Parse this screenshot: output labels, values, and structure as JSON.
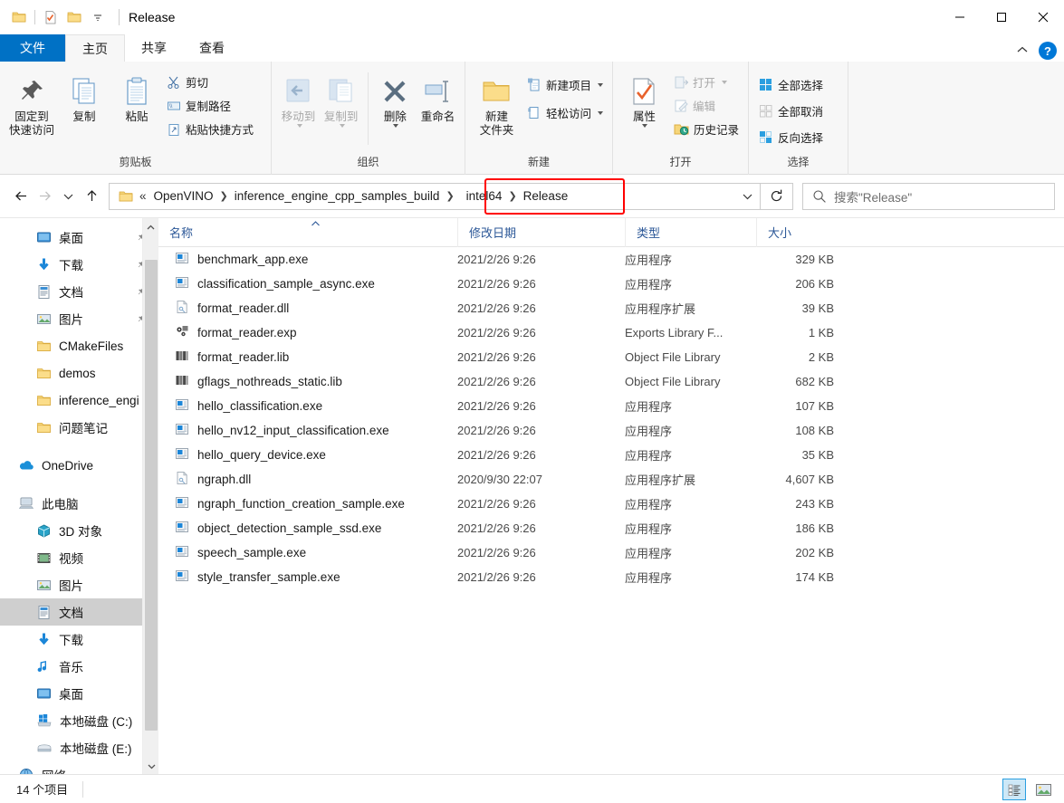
{
  "window": {
    "title": "Release",
    "quick_access": [
      "folder-icon",
      "properties-icon",
      "new-folder-icon",
      "customize-dropdown-icon"
    ],
    "controls": {
      "minimize": "minimize-icon",
      "maximize": "maximize-icon",
      "close": "close-icon"
    }
  },
  "ribbon": {
    "tabs": [
      {
        "label": "文件",
        "kind": "file"
      },
      {
        "label": "主页",
        "kind": "active"
      },
      {
        "label": "共享",
        "kind": "normal"
      },
      {
        "label": "查看",
        "kind": "normal"
      }
    ],
    "collapse_label": "^",
    "help_label": "?",
    "groups": [
      {
        "label": "剪贴板",
        "big": [
          {
            "label": "固定到\n快速访问",
            "line1": "固定到",
            "line2": "快速访问",
            "icon": "pin-icon"
          },
          {
            "label": "复制",
            "icon": "copy-icon"
          },
          {
            "label": "粘贴",
            "icon": "paste-icon"
          }
        ],
        "small": [
          {
            "label": "剪切",
            "icon": "scissors-icon"
          },
          {
            "label": "复制路径",
            "icon": "copy-path-icon"
          },
          {
            "label": "粘贴快捷方式",
            "icon": "paste-shortcut-icon"
          }
        ]
      },
      {
        "label": "组织",
        "big": [
          {
            "label": "移动到",
            "icon": "move-to-icon",
            "disabled": true,
            "dropdown": true
          },
          {
            "label": "复制到",
            "icon": "copy-to-icon",
            "disabled": true,
            "dropdown": true
          },
          {
            "label": "删除",
            "icon": "delete-icon",
            "dropdown": true
          },
          {
            "label": "重命名",
            "icon": "rename-icon"
          }
        ]
      },
      {
        "label": "新建",
        "big": [
          {
            "line1": "新建",
            "line2": "文件夹",
            "label": "新建文件夹",
            "icon": "new-folder-icon"
          }
        ],
        "small": [
          {
            "label": "新建项目",
            "icon": "new-item-icon",
            "dropdown": true
          },
          {
            "label": "轻松访问",
            "icon": "easy-access-icon",
            "dropdown": true
          }
        ]
      },
      {
        "label": "打开",
        "big": [
          {
            "label": "属性",
            "icon": "properties-icon",
            "dropdown": true
          }
        ],
        "small": [
          {
            "label": "打开",
            "icon": "open-icon",
            "disabled": true,
            "dropdown": true
          },
          {
            "label": "编辑",
            "icon": "edit-icon",
            "disabled": true
          },
          {
            "label": "历史记录",
            "icon": "history-icon"
          }
        ]
      },
      {
        "label": "选择",
        "small": [
          {
            "label": "全部选择",
            "icon": "select-all-icon"
          },
          {
            "label": "全部取消",
            "icon": "select-none-icon"
          },
          {
            "label": "反向选择",
            "icon": "invert-selection-icon"
          }
        ]
      }
    ]
  },
  "address": {
    "back": "back-arrow-icon",
    "forward": "forward-arrow-icon",
    "recent": "recent-dropdown-icon",
    "up": "up-arrow-icon",
    "folder_icon": "folder-icon",
    "overflow": "«",
    "crumbs": [
      "OpenVINO",
      "inference_engine_cpp_samples_build",
      "intel64",
      "Release"
    ],
    "highlighted_crumbs": [
      "intel64",
      "Release"
    ],
    "highlight_color": "#ff0000",
    "dropdown": "chevron-down-icon",
    "refresh": "refresh-icon",
    "search_placeholder": "搜索\"Release\""
  },
  "sidebar": {
    "items": [
      {
        "label": "桌面",
        "icon": "desktop-icon",
        "indent": 1,
        "pinned": true
      },
      {
        "label": "下载",
        "icon": "download-icon",
        "indent": 1,
        "pinned": true
      },
      {
        "label": "文档",
        "icon": "document-icon",
        "indent": 1,
        "pinned": true
      },
      {
        "label": "图片",
        "icon": "picture-icon",
        "indent": 1,
        "pinned": true
      },
      {
        "label": "CMakeFiles",
        "icon": "folder-icon",
        "indent": 1
      },
      {
        "label": "demos",
        "icon": "folder-icon",
        "indent": 1
      },
      {
        "label": "inference_engi",
        "icon": "folder-icon",
        "indent": 1
      },
      {
        "label": "问题笔记",
        "icon": "folder-icon",
        "indent": 1
      },
      {
        "label": "OneDrive",
        "icon": "onedrive-icon",
        "indent": 0,
        "spacer_before": true
      },
      {
        "label": "此电脑",
        "icon": "this-pc-icon",
        "indent": 0,
        "spacer_before": true
      },
      {
        "label": "3D 对象",
        "icon": "3d-objects-icon",
        "indent": 1
      },
      {
        "label": "视频",
        "icon": "videos-icon",
        "indent": 1
      },
      {
        "label": "图片",
        "icon": "picture-icon",
        "indent": 1
      },
      {
        "label": "文档",
        "icon": "document-icon",
        "indent": 1,
        "selected": true
      },
      {
        "label": "下载",
        "icon": "download-icon",
        "indent": 1
      },
      {
        "label": "音乐",
        "icon": "music-icon",
        "indent": 1
      },
      {
        "label": "桌面",
        "icon": "desktop-icon",
        "indent": 1
      },
      {
        "label": "本地磁盘 (C:)",
        "icon": "windows-drive-icon",
        "indent": 1
      },
      {
        "label": "本地磁盘 (E:)",
        "icon": "drive-icon",
        "indent": 1
      },
      {
        "label": "网络",
        "icon": "network-icon",
        "indent": 0
      }
    ],
    "scroll_up": "scroll-up-icon",
    "scroll_down": "scroll-down-icon"
  },
  "filelist": {
    "columns": [
      {
        "label": "名称",
        "key": "name",
        "sorted": true,
        "sort_dir": "asc"
      },
      {
        "label": "修改日期",
        "key": "date"
      },
      {
        "label": "类型",
        "key": "type"
      },
      {
        "label": "大小",
        "key": "size"
      }
    ],
    "rows": [
      {
        "name": "benchmark_app.exe",
        "date": "2021/2/26 9:26",
        "type": "应用程序",
        "size": "329 KB",
        "icon": "exe-icon"
      },
      {
        "name": "classification_sample_async.exe",
        "date": "2021/2/26 9:26",
        "type": "应用程序",
        "size": "206 KB",
        "icon": "exe-icon"
      },
      {
        "name": "format_reader.dll",
        "date": "2021/2/26 9:26",
        "type": "应用程序扩展",
        "size": "39 KB",
        "icon": "dll-icon"
      },
      {
        "name": "format_reader.exp",
        "date": "2021/2/26 9:26",
        "type": "Exports Library F...",
        "size": "1 KB",
        "icon": "exp-icon"
      },
      {
        "name": "format_reader.lib",
        "date": "2021/2/26 9:26",
        "type": "Object File Library",
        "size": "2 KB",
        "icon": "lib-icon"
      },
      {
        "name": "gflags_nothreads_static.lib",
        "date": "2021/2/26 9:26",
        "type": "Object File Library",
        "size": "682 KB",
        "icon": "lib-icon"
      },
      {
        "name": "hello_classification.exe",
        "date": "2021/2/26 9:26",
        "type": "应用程序",
        "size": "107 KB",
        "icon": "exe-icon"
      },
      {
        "name": "hello_nv12_input_classification.exe",
        "date": "2021/2/26 9:26",
        "type": "应用程序",
        "size": "108 KB",
        "icon": "exe-icon"
      },
      {
        "name": "hello_query_device.exe",
        "date": "2021/2/26 9:26",
        "type": "应用程序",
        "size": "35 KB",
        "icon": "exe-icon"
      },
      {
        "name": "ngraph.dll",
        "date": "2020/9/30 22:07",
        "type": "应用程序扩展",
        "size": "4,607 KB",
        "icon": "dll-icon"
      },
      {
        "name": "ngraph_function_creation_sample.exe",
        "date": "2021/2/26 9:26",
        "type": "应用程序",
        "size": "243 KB",
        "icon": "exe-icon"
      },
      {
        "name": "object_detection_sample_ssd.exe",
        "date": "2021/2/26 9:26",
        "type": "应用程序",
        "size": "186 KB",
        "icon": "exe-icon"
      },
      {
        "name": "speech_sample.exe",
        "date": "2021/2/26 9:26",
        "type": "应用程序",
        "size": "202 KB",
        "icon": "exe-icon"
      },
      {
        "name": "style_transfer_sample.exe",
        "date": "2021/2/26 9:26",
        "type": "应用程序",
        "size": "174 KB",
        "icon": "exe-icon"
      }
    ]
  },
  "status": {
    "item_count": "14 个项目",
    "view_details": "details-view-icon",
    "view_large_icons": "large-icons-view-icon",
    "selected_view": "details"
  }
}
